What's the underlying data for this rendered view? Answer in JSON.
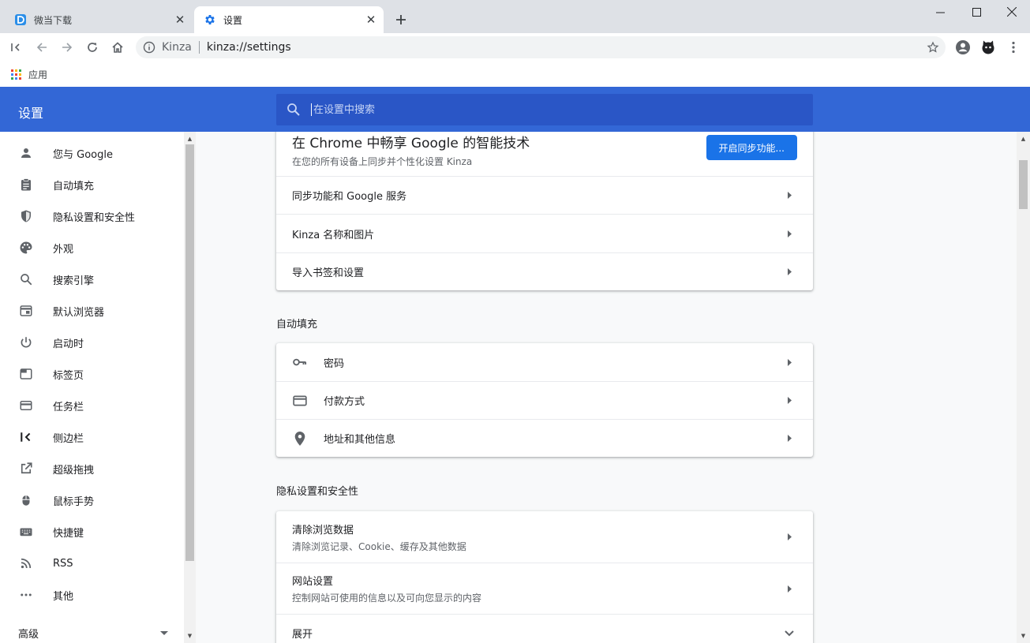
{
  "tabs": [
    {
      "title": "微当下载",
      "active": false
    },
    {
      "title": "设置",
      "active": true
    }
  ],
  "omnibox": {
    "site": "Kinza",
    "url": "kinza://settings"
  },
  "bookmarks": {
    "apps_label": "应用"
  },
  "header": {
    "title": "设置",
    "search_placeholder": "在设置中搜索"
  },
  "nav": {
    "items": [
      {
        "label": "您与 Google",
        "icon": "person-icon"
      },
      {
        "label": "自动填充",
        "icon": "clipboard-icon"
      },
      {
        "label": "隐私设置和安全性",
        "icon": "shield-icon"
      },
      {
        "label": "外观",
        "icon": "palette-icon"
      },
      {
        "label": "搜索引擎",
        "icon": "search-icon"
      },
      {
        "label": "默认浏览器",
        "icon": "browser-window-icon"
      },
      {
        "label": "启动时",
        "icon": "power-icon"
      },
      {
        "label": "标签页",
        "icon": "tab-icon"
      },
      {
        "label": "任务栏",
        "icon": "taskbar-icon"
      },
      {
        "label": "侧边栏",
        "icon": "sidebar-collapse-icon"
      },
      {
        "label": "超级拖拽",
        "icon": "open-in-new-icon"
      },
      {
        "label": "鼠标手势",
        "icon": "mouse-icon"
      },
      {
        "label": "快捷键",
        "icon": "keyboard-icon"
      },
      {
        "label": "RSS",
        "icon": "rss-icon"
      },
      {
        "label": "其他",
        "icon": "more-horiz-icon"
      }
    ],
    "advanced_label": "高级"
  },
  "sync_card": {
    "title": "在 Chrome 中畅享 Google 的智能技术",
    "subtitle": "在您的所有设备上同步并个性化设置 Kinza",
    "button_label": "开启同步功能...",
    "rows": [
      "同步功能和 Google 服务",
      "Kinza 名称和图片",
      "导入书签和设置"
    ]
  },
  "autofill": {
    "section_title": "自动填充",
    "rows": [
      {
        "label": "密码",
        "icon": "key-icon"
      },
      {
        "label": "付款方式",
        "icon": "credit-card-icon"
      },
      {
        "label": "地址和其他信息",
        "icon": "location-pin-icon"
      }
    ]
  },
  "privacy": {
    "section_title": "隐私设置和安全性",
    "rows": [
      {
        "label": "清除浏览数据",
        "sub": "清除浏览记录、Cookie、缓存及其他数据"
      },
      {
        "label": "网站设置",
        "sub": "控制网站可使用的信息以及可向您显示的内容"
      }
    ],
    "expand_label": "展开"
  },
  "colors": {
    "header_blue": "#3367d6",
    "search_blue": "#2a56c6",
    "button_blue": "#1a73e8"
  }
}
